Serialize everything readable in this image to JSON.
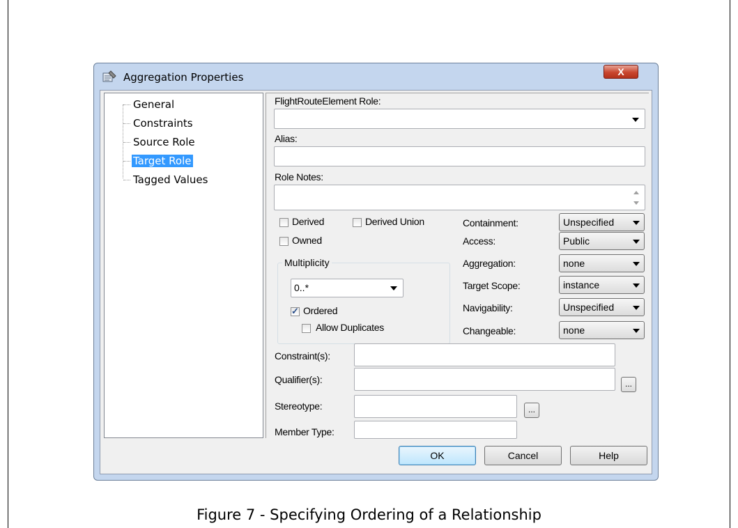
{
  "dialog": {
    "title": "Aggregation Properties",
    "close_label": "X"
  },
  "tree": {
    "items": [
      {
        "label": "General",
        "selected": false
      },
      {
        "label": "Constraints",
        "selected": false
      },
      {
        "label": "Source Role",
        "selected": false
      },
      {
        "label": "Target Role",
        "selected": true
      },
      {
        "label": "Tagged Values",
        "selected": false
      }
    ]
  },
  "form": {
    "role_label": "FlightRouteElement Role:",
    "role_value": "",
    "alias_label": "Alias:",
    "alias_value": "",
    "role_notes_label": "Role Notes:",
    "role_notes_value": "",
    "derived_label": "Derived",
    "derived_checked": false,
    "derived_union_label": "Derived Union",
    "derived_union_checked": false,
    "owned_label": "Owned",
    "owned_checked": false,
    "multiplicity": {
      "group_label": "Multiplicity",
      "value": "0..*",
      "ordered_label": "Ordered",
      "ordered_checked": true,
      "allow_duplicates_label": "Allow Duplicates",
      "allow_duplicates_checked": false
    },
    "containment_label": "Containment:",
    "containment_value": "Unspecified",
    "access_label": "Access:",
    "access_value": "Public",
    "aggregation_label": "Aggregation:",
    "aggregation_value": "none",
    "target_scope_label": "Target Scope:",
    "target_scope_value": "instance",
    "navigability_label": "Navigability:",
    "navigability_value": "Unspecified",
    "changeable_label": "Changeable:",
    "changeable_value": "none",
    "constraints_label": "Constraint(s):",
    "constraints_value": "",
    "qualifiers_label": "Qualifier(s):",
    "qualifiers_value": "",
    "stereotype_label": "Stereotype:",
    "stereotype_value": "",
    "member_type_label": "Member Type:",
    "member_type_value": "",
    "ellipsis_label": "..."
  },
  "buttons": {
    "ok": "OK",
    "cancel": "Cancel",
    "help": "Help"
  },
  "caption": "Figure 7 - Specifying Ordering of a Relationship"
}
